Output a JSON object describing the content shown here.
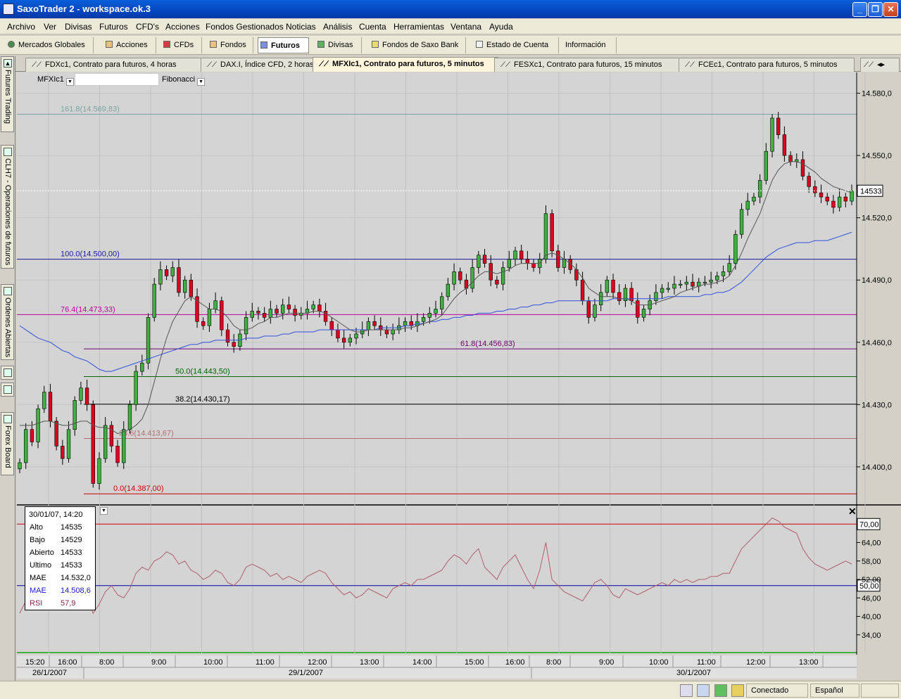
{
  "window": {
    "title": "SaxoTrader 2 - workspace.ok.3"
  },
  "menu": [
    "Archivo",
    "Ver",
    "Divisas",
    "Futuros",
    "CFD's",
    "Acciones",
    "Fondos Gestionados",
    "Noticias",
    "Análisis",
    "Cuenta",
    "Herramientas",
    "Ventana",
    "Ayuda"
  ],
  "toolbar": [
    "Mercados Globales",
    "Acciones",
    "CFDs",
    "Fondos",
    "Futuros",
    "Divisas",
    "Fondos de Saxo Bank",
    "Estado de Cuenta",
    "Información"
  ],
  "tabs": [
    "FDXc1, Contrato para futuros, 4 horas",
    "DAX.I, Índice CFD, 2 horas",
    "MFXIc1, Contrato para futuros, 5 minutos",
    "FESXc1, Contrato para futuros, 15 minutos",
    "FCEc1, Contrato para futuros, 5 minutos"
  ],
  "sidebar": [
    "Futures Trading",
    "CLH7 - Operaciones de futuros",
    "Ordenes Abiertas",
    "Forex Board"
  ],
  "chart_controls": {
    "symbol": "MFXIc1",
    "tool": "Fibonacci",
    "symbol_input": ""
  },
  "chart_data": {
    "type": "candlestick",
    "title": "MFXIc1, Contrato para futuros, 5 minutos",
    "ylim": [
      14382,
      14590
    ],
    "yticks": [
      "14.400,0",
      "14.430,0",
      "14.460,0",
      "14.490,0",
      "14.520,0",
      "14.550,0",
      "14.580,0"
    ],
    "last_price": "14533",
    "fibonacci": [
      {
        "label": "161.8(14.569,83)",
        "value": 14569.83,
        "color": "#7aa5a5"
      },
      {
        "label": "100.0(14.500,00)",
        "value": 14500.0,
        "color": "#1a1aa0"
      },
      {
        "label": "76.4(14.473,33)",
        "value": 14473.33,
        "color": "#c000a0"
      },
      {
        "label": "61.8(14.456,83)",
        "value": 14456.83,
        "color": "#700070"
      },
      {
        "label": "50.0(14.443,50)",
        "value": 14443.5,
        "color": "#006600"
      },
      {
        "label": "38.2(14.430,17)",
        "value": 14430.17,
        "color": "#000000"
      },
      {
        "label": "23.6(14.413,67)",
        "value": 14413.67,
        "color": "#b07070"
      },
      {
        "label": "0.0(14.387,00)",
        "value": 14387.0,
        "color": "#cc0000"
      }
    ],
    "time_labels": [
      "15:20",
      "16:00",
      "8:00",
      "9:00",
      "10:00",
      "11:00",
      "12:00",
      "13:00",
      "14:00",
      "15:00",
      "16:00",
      "8:00",
      "9:00",
      "10:00",
      "11:00",
      "12:00",
      "13:00"
    ],
    "date_labels": [
      "26/1/2007",
      "29/1/2007",
      "30/1/2007"
    ],
    "closes": [
      14402,
      14418,
      14412,
      14428,
      14436,
      14422,
      14410,
      14404,
      14418,
      14432,
      14438,
      14430,
      14392,
      14404,
      14420,
      14410,
      14402,
      14418,
      14430,
      14446,
      14450,
      14472,
      14488,
      14495,
      14492,
      14496,
      14484,
      14490,
      14482,
      14470,
      14468,
      14476,
      14480,
      14466,
      14460,
      14458,
      14464,
      14472,
      14475,
      14474,
      14472,
      14476,
      14474,
      14478,
      14476,
      14473,
      14474,
      14476,
      14478,
      14475,
      14470,
      14466,
      14462,
      14460,
      14462,
      14464,
      14466,
      14470,
      14468,
      14466,
      14464,
      14466,
      14468,
      14470,
      14468,
      14470,
      14472,
      14474,
      14476,
      14482,
      14488,
      14494,
      14490,
      14486,
      14496,
      14502,
      14498,
      14490,
      14488,
      14496,
      14500,
      14504,
      14500,
      14498,
      14496,
      14500,
      14522,
      14504,
      14496,
      14500,
      14495,
      14490,
      14480,
      14472,
      14478,
      14484,
      14490,
      14484,
      14480,
      14486,
      14480,
      14472,
      14476,
      14480,
      14484,
      14486,
      14486,
      14488,
      14488,
      14489,
      14487,
      14489,
      14489,
      14490,
      14492,
      14494,
      14498,
      14512,
      14524,
      14528,
      14530,
      14538,
      14552,
      14568,
      14560,
      14550,
      14547,
      14548,
      14540,
      14535,
      14532,
      14530,
      14528,
      14525,
      14530,
      14528,
      14533
    ],
    "mae_fast": [
      14420,
      14420,
      14420,
      14421,
      14422,
      14422,
      14421,
      14420,
      14420,
      14421,
      14422,
      14422,
      14420,
      14419,
      14419,
      14418,
      14416,
      14417,
      14418,
      14420,
      14423,
      14430,
      14441,
      14452,
      14462,
      14470,
      14475,
      14480,
      14482,
      14480,
      14478,
      14476,
      14476,
      14475,
      14472,
      14468,
      14466,
      14466,
      14467,
      14469,
      14470,
      14472,
      14472,
      14473,
      14474,
      14474,
      14474,
      14474,
      14475,
      14475,
      14474,
      14472,
      14470,
      14468,
      14466,
      14465,
      14465,
      14466,
      14466,
      14466,
      14466,
      14466,
      14466,
      14467,
      14467,
      14468,
      14469,
      14470,
      14471,
      14473,
      14477,
      14481,
      14484,
      14486,
      14489,
      14492,
      14494,
      14494,
      14493,
      14494,
      14495,
      14497,
      14498,
      14498,
      14498,
      14498,
      14502,
      14503,
      14502,
      14500,
      14498,
      14495,
      14491,
      14486,
      14484,
      14482,
      14482,
      14482,
      14481,
      14481,
      14480,
      14478,
      14478,
      14478,
      14479,
      14480,
      14481,
      14482,
      14484,
      14485,
      14486,
      14487,
      14488,
      14488,
      14489,
      14490,
      14492,
      14497,
      14503,
      14510,
      14516,
      14522,
      14530,
      14538,
      14543,
      14546,
      14547,
      14547,
      14546,
      14544,
      14542,
      14539,
      14537,
      14535,
      14534,
      14533,
      14532
    ],
    "mae_slow": [
      14468,
      14466,
      14464,
      14462,
      14461,
      14460,
      14458,
      14456,
      14455,
      14453,
      14452,
      14451,
      14449,
      14447,
      14446,
      14446,
      14447,
      14448,
      14449,
      14450,
      14451,
      14452,
      14453,
      14454,
      14455,
      14456,
      14457,
      14458,
      14459,
      14459,
      14460,
      14460,
      14461,
      14461,
      14461,
      14461,
      14461,
      14462,
      14462,
      14462,
      14463,
      14463,
      14463,
      14464,
      14464,
      14465,
      14465,
      14465,
      14465,
      14466,
      14466,
      14466,
      14466,
      14466,
      14466,
      14466,
      14466,
      14466,
      14466,
      14467,
      14467,
      14467,
      14467,
      14468,
      14468,
      14469,
      14469,
      14470,
      14470,
      14471,
      14471,
      14472,
      14472,
      14473,
      14473,
      14474,
      14474,
      14474,
      14475,
      14475,
      14476,
      14476,
      14477,
      14477,
      14478,
      14478,
      14479,
      14479,
      14480,
      14480,
      14480,
      14480,
      14480,
      14480,
      14480,
      14480,
      14480,
      14481,
      14481,
      14481,
      14481,
      14481,
      14481,
      14481,
      14481,
      14481,
      14482,
      14482,
      14482,
      14482,
      14482,
      14482,
      14483,
      14483,
      14484,
      14484,
      14485,
      14487,
      14489,
      14492,
      14495,
      14498,
      14501,
      14503,
      14505,
      14506,
      14507,
      14508,
      14508,
      14508,
      14509,
      14509,
      14509,
      14510,
      14511,
      14512,
      14513
    ],
    "rsi": {
      "ylim": [
        28,
        76
      ],
      "yticks": [
        "34,00",
        "40,00",
        "46,00",
        "52,00",
        "58,00",
        "64,00"
      ],
      "levels": [
        {
          "label": "70,00",
          "value": 70,
          "color": "#cc0000"
        },
        {
          "label": "50,00",
          "value": 50,
          "color": "#0000aa"
        }
      ],
      "values": [
        41,
        45,
        48,
        44,
        42,
        50,
        48,
        44,
        42,
        44,
        43,
        46,
        41,
        44,
        48,
        50,
        47,
        46,
        49,
        54,
        56,
        55,
        58,
        59,
        61,
        60,
        57,
        58,
        55,
        54,
        52,
        53,
        55,
        54,
        51,
        50,
        52,
        56,
        57,
        56,
        55,
        53,
        54,
        52,
        53,
        52,
        51,
        53,
        54,
        55,
        54,
        51,
        49,
        47,
        48,
        46,
        47,
        49,
        48,
        47,
        46,
        49,
        50,
        51,
        50,
        52,
        52,
        53,
        54,
        55,
        58,
        60,
        59,
        57,
        60,
        62,
        56,
        54,
        52,
        56,
        58,
        60,
        56,
        52,
        49,
        55,
        64,
        52,
        50,
        48,
        47,
        46,
        45,
        48,
        51,
        52,
        50,
        47,
        46,
        49,
        48,
        47,
        48,
        49,
        50,
        51,
        50,
        52,
        51,
        52,
        51,
        52,
        52,
        53,
        53,
        54,
        54,
        58,
        62,
        64,
        66,
        68,
        70,
        72,
        71,
        69,
        68,
        67,
        62,
        59,
        57,
        56,
        55,
        56,
        57,
        58,
        57
      ]
    }
  },
  "data_panel": {
    "datetime": "30/01/07, 14:20",
    "rows": [
      {
        "label": "Alto",
        "value": "14535",
        "color": "#000000"
      },
      {
        "label": "Bajo",
        "value": "14529",
        "color": "#000000"
      },
      {
        "label": "Abierto",
        "value": "14533",
        "color": "#000000"
      },
      {
        "label": "Ultimo",
        "value": "14533",
        "color": "#000000"
      },
      {
        "label": "MAE",
        "value": "14.532,0",
        "color": "#000000"
      },
      {
        "label": "MAE",
        "value": "14.508,6",
        "color": "#1a1acc"
      },
      {
        "label": "RSI",
        "value": "57,9",
        "color": "#8a2050"
      }
    ]
  },
  "status": {
    "connection": "Conectado",
    "language": "Español"
  },
  "colors": {
    "up": "#40b040",
    "down": "#e00020",
    "chart_bg": "#d4d4d4",
    "mae_fast": "#555555",
    "mae_slow": "#3050e0",
    "rsi": "#b06070"
  }
}
